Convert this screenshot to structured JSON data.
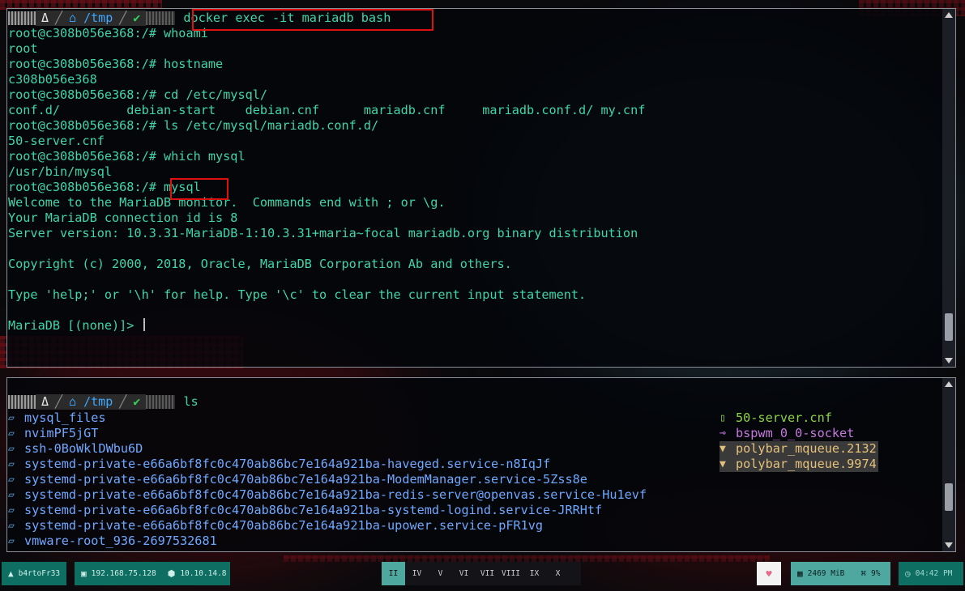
{
  "top_terminal": {
    "prompt": {
      "logo": "Δ",
      "dir_icon": "home-folder-icon",
      "dir": "/tmp",
      "status": "✔"
    },
    "command": "docker exec -it mariadb bash",
    "lines": [
      "root@c308b056e368:/# whoami",
      "root",
      "root@c308b056e368:/# hostname",
      "c308b056e368",
      "root@c308b056e368:/# cd /etc/mysql/",
      "conf.d/         debian-start    debian.cnf      mariadb.cnf     mariadb.conf.d/ my.cnf",
      "root@c308b056e368:/# ls /etc/mysql/mariadb.conf.d/",
      "50-server.cnf",
      "root@c308b056e368:/# which mysql",
      "/usr/bin/mysql",
      "root@c308b056e368:/# mysql",
      "Welcome to the MariaDB monitor.  Commands end with ; or \\g.",
      "Your MariaDB connection id is 8",
      "Server version: 10.3.31-MariaDB-1:10.3.31+maria~focal mariadb.org binary distribution",
      "",
      "Copyright (c) 2000, 2018, Oracle, MariaDB Corporation Ab and others.",
      "",
      "Type 'help;' or '\\h' for help. Type '\\c' to clear the current input statement.",
      "",
      "MariaDB [(none)]> "
    ]
  },
  "bottom_terminal": {
    "prompt": {
      "logo": "Δ",
      "dir": "/tmp",
      "status": "✔"
    },
    "command": "ls",
    "dirs": [
      "mysql_files",
      "nvimPF5jGT",
      "ssh-0BoWklDWbu6D",
      "systemd-private-e66a6bf8fc0c470ab86bc7e164a921ba-haveged.service-n8IqJf",
      "systemd-private-e66a6bf8fc0c470ab86bc7e164a921ba-ModemManager.service-5Zss8e",
      "systemd-private-e66a6bf8fc0c470ab86bc7e164a921ba-redis-server@openvas.service-Hu1evf",
      "systemd-private-e66a6bf8fc0c470ab86bc7e164a921ba-systemd-logind.service-JRRHtf",
      "systemd-private-e66a6bf8fc0c470ab86bc7e164a921ba-upower.service-pFR1vg",
      "vmware-root_936-2697532681"
    ],
    "files": [
      {
        "name": "50-server.cnf",
        "kind": "file",
        "icon": "file-icon"
      },
      {
        "name": "bspwm_0_0-socket",
        "kind": "sock",
        "icon": "socket-icon"
      },
      {
        "name": "polybar_mqueue.2132",
        "kind": "pipe",
        "icon": "pipe-icon"
      },
      {
        "name": "polybar_mqueue.9974",
        "kind": "pipe",
        "icon": "pipe-icon"
      }
    ]
  },
  "polybar": {
    "user": "b4rtoFr33",
    "ip_local": "192.168.75.128",
    "ip_vpn": "10.10.14.8",
    "workspaces": [
      "II",
      "IV",
      "V",
      "VI",
      "VII",
      "VIII",
      "IX",
      "X"
    ],
    "active_workspace": "II",
    "memory": "2469 MiB",
    "cpu": "9%",
    "time": "04:42 PM",
    "colors": {
      "accent": "#0e6e62",
      "highlight": "#4fa8a0",
      "prompt_text": "#3fd6a8"
    }
  }
}
